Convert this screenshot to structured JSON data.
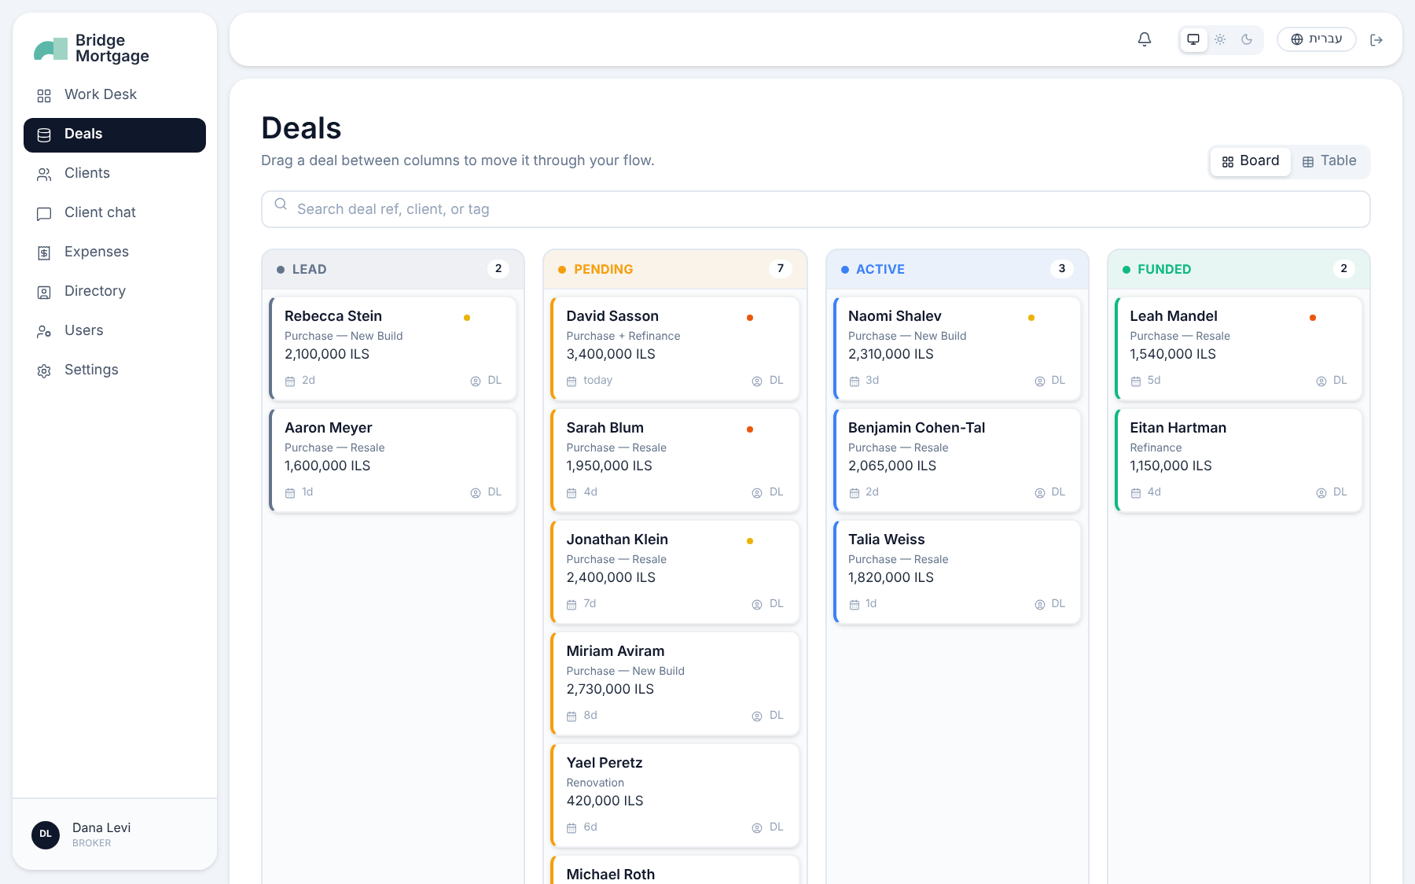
{
  "sidebar": {
    "brand": {
      "line_1": "Bridge",
      "line_2": "Mortgage"
    },
    "items": [
      {
        "label": "Work Desk",
        "selected": false
      },
      {
        "label": "Deals",
        "selected": true
      },
      {
        "label": "Clients",
        "selected": false
      },
      {
        "label": "Client chat",
        "selected": false
      },
      {
        "label": "Expenses",
        "selected": false
      },
      {
        "label": "Directory",
        "selected": false
      },
      {
        "label": "Users",
        "selected": false
      },
      {
        "label": "Settings",
        "selected": false
      }
    ],
    "user": {
      "initials": "DL",
      "name": "Dana Levi",
      "role": "BROKER"
    }
  },
  "topbar": {
    "theme_options": [
      {
        "selected": true
      },
      {
        "selected": false
      },
      {
        "selected": false
      }
    ],
    "language": "עברית"
  },
  "page": {
    "title": "Deals",
    "subtitle": "Drag a deal between columns to move it through your flow.",
    "views": [
      {
        "label": "Board",
        "selected": true
      },
      {
        "label": "Table",
        "selected": false
      }
    ],
    "search": {
      "placeholder": "Search deal ref, client, or tag"
    }
  },
  "columns": [
    {
      "title": "LEAD",
      "count": "2",
      "color": "#64748b",
      "cards": [
        {
          "name": "Rebecca Stein",
          "type": "Purchase — New Build",
          "amount": "2,100,000 ILS",
          "age": "2d",
          "owner": "DL",
          "color": "#eab308"
        },
        {
          "name": "Aaron Meyer",
          "type": "Purchase — Resale",
          "amount": "1,600,000 ILS",
          "age": "1d",
          "owner": "DL"
        }
      ]
    },
    {
      "title": "PENDING",
      "count": "7",
      "color": "#f59e0b",
      "cards": [
        {
          "name": "David Sasson",
          "type": "Purchase + Refinance",
          "amount": "3,400,000 ILS",
          "age": "today",
          "owner": "DL",
          "color": "#ea580c"
        },
        {
          "name": "Sarah Blum",
          "type": "Purchase — Resale",
          "amount": "1,950,000 ILS",
          "age": "4d",
          "owner": "DL",
          "color": "#ea580c"
        },
        {
          "name": "Jonathan Klein",
          "type": "Purchase — Resale",
          "amount": "2,400,000 ILS",
          "age": "7d",
          "owner": "DL",
          "color": "#eab308"
        },
        {
          "name": "Miriam Aviram",
          "type": "Purchase — New Build",
          "amount": "2,730,000 ILS",
          "age": "8d",
          "owner": "DL"
        },
        {
          "name": "Yael Peretz",
          "type": "Renovation",
          "amount": "420,000 ILS",
          "age": "6d",
          "owner": "DL"
        },
        {
          "name": "Michael Roth"
        }
      ]
    },
    {
      "title": "ACTIVE",
      "count": "3",
      "color": "#3b82f6",
      "cards": [
        {
          "name": "Naomi Shalev",
          "type": "Purchase — New Build",
          "amount": "2,310,000 ILS",
          "age": "3d",
          "owner": "DL",
          "color": "#eab308"
        },
        {
          "name": "Benjamin Cohen-Tal",
          "type": "Purchase — Resale",
          "amount": "2,065,000 ILS",
          "age": "2d",
          "owner": "DL"
        },
        {
          "name": "Talia Weiss",
          "type": "Purchase — Resale",
          "amount": "1,820,000 ILS",
          "age": "1d",
          "owner": "DL"
        }
      ]
    },
    {
      "title": "FUNDED",
      "count": "2",
      "color": "#10b981",
      "cards": [
        {
          "name": "Leah Mandel",
          "type": "Purchase — Resale",
          "amount": "1,540,000 ILS",
          "age": "5d",
          "owner": "DL",
          "color": "#ea580c"
        },
        {
          "name": "Eitan Hartman",
          "type": "Refinance",
          "amount": "1,150,000 ILS",
          "age": "4d",
          "owner": "DL"
        }
      ]
    }
  ]
}
